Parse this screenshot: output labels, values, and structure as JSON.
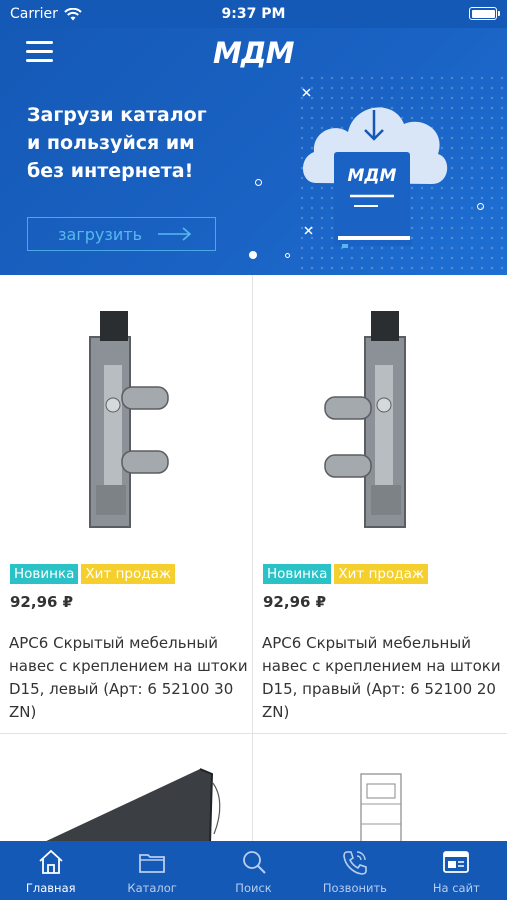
{
  "status_bar": {
    "carrier": "Carrier",
    "time": "9:37 PM"
  },
  "header": {
    "logo": "МДМ",
    "menu_icon": "hamburger-icon"
  },
  "banner": {
    "text": "Загрузи каталог\nи пользуйся им\nбез интернета!",
    "button_label": "загрузить",
    "book_logo": "МДМ"
  },
  "products": [
    {
      "badges": [
        "Новинка",
        "Хит продаж"
      ],
      "price": "92,96 ₽",
      "title": "APC6 Скрытый мебельный навес с креплением на штоки D15, левый (Арт: 6 52100 30 ZN)"
    },
    {
      "badges": [
        "Новинка",
        "Хит продаж"
      ],
      "price": "92,96 ₽",
      "title": "APC6 Скрытый мебельный навес с креплением на штоки D15, правый (Арт: 6 52100 20 ZN)"
    }
  ],
  "tabbar": {
    "items": [
      {
        "label": "Главная",
        "icon": "home-icon",
        "active": true
      },
      {
        "label": "Каталог",
        "icon": "folder-icon",
        "active": false
      },
      {
        "label": "Поиск",
        "icon": "search-icon",
        "active": false
      },
      {
        "label": "Позвонить",
        "icon": "phone-icon",
        "active": false
      },
      {
        "label": "На сайт",
        "icon": "browser-icon",
        "active": false
      }
    ]
  },
  "colors": {
    "primary": "#1559b6",
    "badge_new": "#2ac2c6",
    "badge_hit": "#f4cf2e"
  }
}
